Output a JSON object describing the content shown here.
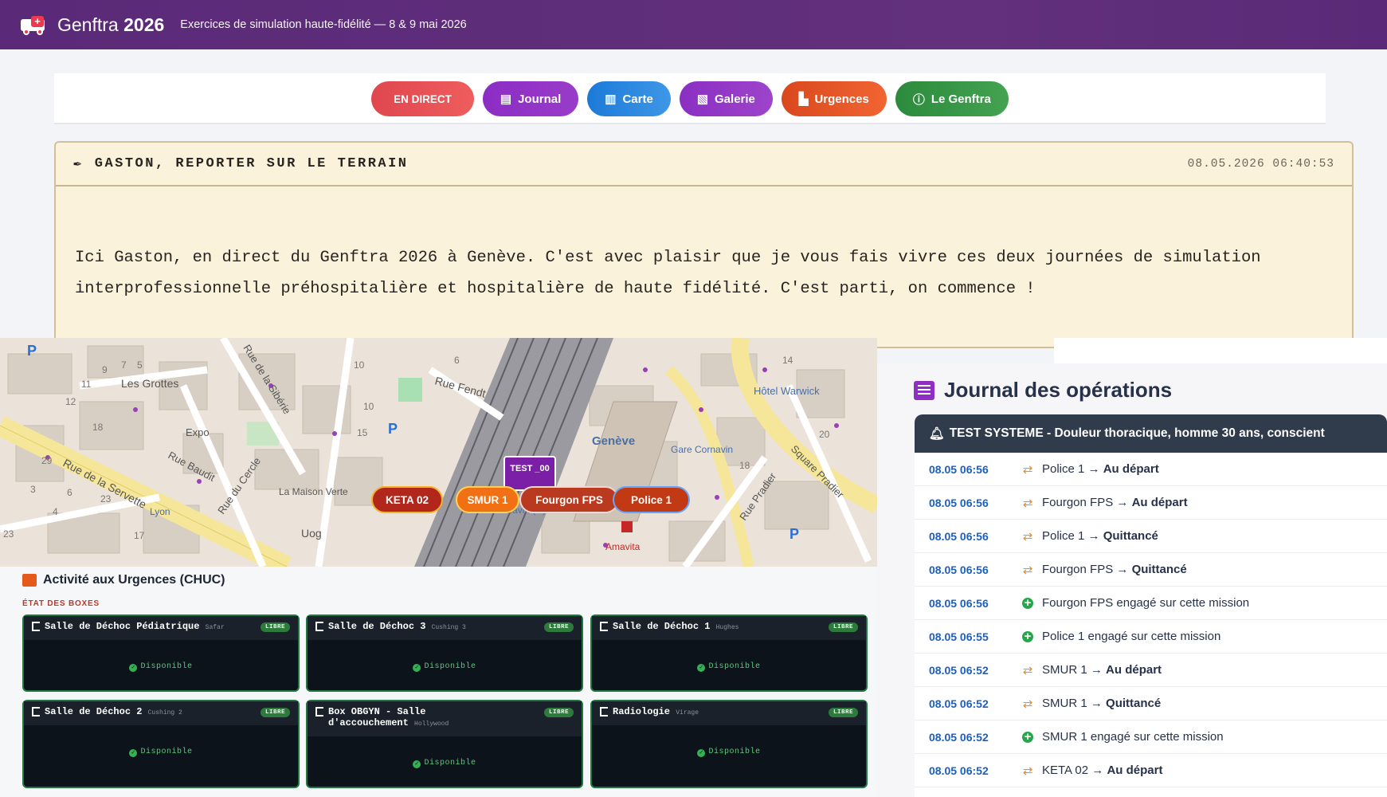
{
  "header": {
    "brand": "Genftra",
    "year": "2026",
    "tagline": "Exercices de simulation haute-fidélité — 8 & 9 mai 2026"
  },
  "nav": [
    {
      "label": "EN DIRECT",
      "icon": "live-icon"
    },
    {
      "label": "Journal",
      "icon": "newspaper-icon"
    },
    {
      "label": "Carte",
      "icon": "map-icon"
    },
    {
      "label": "Galerie",
      "icon": "images-icon"
    },
    {
      "label": "Urgences",
      "icon": "hospital-icon"
    },
    {
      "label": "Le Genftra",
      "icon": "info-icon"
    }
  ],
  "reporter": {
    "title": "GASTON, REPORTER SUR LE TERRAIN",
    "timestamp": "08.05.2026 06:40:53",
    "text": "Ici Gaston, en direct du Genftra 2026 à Genève. C'est avec plaisir que je vous fais vivre ces deux journées de simulation interprofessionnelle préhospitalière et hospitalière de haute fidélité. C'est parti, on commence !"
  },
  "map": {
    "labels": {
      "grottes": "Les Grottes",
      "expo": "Expo",
      "maison_verte": "La Maison Verte",
      "uog": "Uog",
      "lyon": "Lyon",
      "geneve": "Genève",
      "gare_cornavin": "Gare Cornavin",
      "gare_cornavin_h": "Gare Cornavin (H)",
      "hotel_warwick": "Hôtel Warwick",
      "amavita": "Amavita",
      "rue_fendt": "Rue Fendt",
      "rue_servette": "Rue de la Servette",
      "rue_baudit": "Rue Baudit",
      "rue_cercle": "Rue du Cercle",
      "rue_siberie": "Rue de la Sibérie",
      "rue_pradier": "Rue Pradier",
      "square_pradier": "Square Pradier",
      "expo_num": "15",
      "n9": "9",
      "n7": "7",
      "n5": "5",
      "n10": "10",
      "n6": "6",
      "n12": "12",
      "n18": "18",
      "n29": "29",
      "n3": "3",
      "n6b": "6",
      "n23": "23",
      "n4": "4",
      "n17": "17",
      "n23b": "23",
      "n11": "11",
      "n10b": "10",
      "n14": "14",
      "n20": "20",
      "n18b": "18"
    },
    "test_marker": "TEST _00",
    "markers": [
      {
        "label": "KETA 02"
      },
      {
        "label": "SMUR 1"
      },
      {
        "label": "Fourgon FPS"
      },
      {
        "label": "Police 1"
      }
    ]
  },
  "journal": {
    "title": "Journal des opérations",
    "mission": "TEST SYSTEME - Douleur thoracique, homme 30 ans, conscient",
    "rows": [
      {
        "time": "08.05 06:56",
        "type": "status",
        "unit": "Police 1",
        "arrow": "→",
        "status": "Au départ"
      },
      {
        "time": "08.05 06:56",
        "type": "status",
        "unit": "Fourgon FPS",
        "arrow": "→",
        "status": "Au départ"
      },
      {
        "time": "08.05 06:56",
        "type": "status",
        "unit": "Police 1",
        "arrow": "→",
        "status": "Quittancé"
      },
      {
        "time": "08.05 06:56",
        "type": "status",
        "unit": "Fourgon FPS",
        "arrow": "→",
        "status": "Quittancé"
      },
      {
        "time": "08.05 06:56",
        "type": "engage",
        "unit": "Fourgon FPS",
        "text": "engagé sur cette mission"
      },
      {
        "time": "08.05 06:55",
        "type": "engage",
        "unit": "Police 1",
        "text": "engagé sur cette mission"
      },
      {
        "time": "08.05 06:52",
        "type": "status",
        "unit": "SMUR 1",
        "arrow": "→",
        "status": "Au départ"
      },
      {
        "time": "08.05 06:52",
        "type": "status",
        "unit": "SMUR 1",
        "arrow": "→",
        "status": "Quittancé"
      },
      {
        "time": "08.05 06:52",
        "type": "engage",
        "unit": "SMUR 1",
        "text": "engagé sur cette mission"
      },
      {
        "time": "08.05 06:52",
        "type": "status",
        "unit": "KETA 02",
        "arrow": "→",
        "status": "Au départ"
      }
    ]
  },
  "urgences": {
    "title": "Activité aux Urgences (CHUC)",
    "state_label": "ÉTAT DES BOXES",
    "boxes": [
      {
        "name": "Salle de Déchoc Pédiatrique",
        "sub": "Safar",
        "badge": "LIBRE",
        "status": "Disponible"
      },
      {
        "name": "Salle de Déchoc 3",
        "sub": "Cushing 3",
        "badge": "LIBRE",
        "status": "Disponible"
      },
      {
        "name": "Salle de Déchoc 1",
        "sub": "Hughes",
        "badge": "LIBRE",
        "status": "Disponible"
      },
      {
        "name": "Salle de Déchoc 2",
        "sub": "Cushing 2",
        "badge": "LIBRE",
        "status": "Disponible"
      },
      {
        "name": "Box OBGYN - Salle d'accouchement",
        "sub": "Hollywood",
        "badge": "LIBRE",
        "status": "Disponible"
      },
      {
        "name": "Radiologie",
        "sub": "Virage",
        "badge": "LIBRE",
        "status": "Disponible"
      }
    ]
  }
}
